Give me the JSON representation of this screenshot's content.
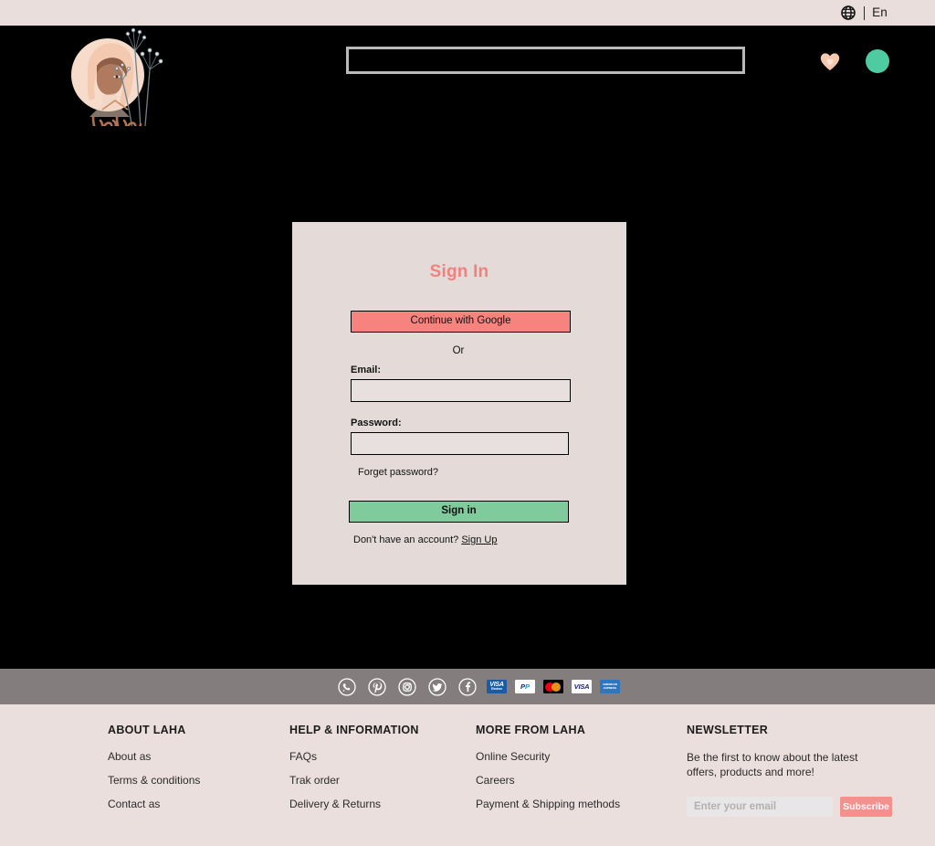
{
  "topbar": {
    "globe_icon": "globe-icon",
    "language": "En"
  },
  "header": {
    "logo_alt": "Laha",
    "search_placeholder": "",
    "search_value": "",
    "wishlist_icon": "heart-icon",
    "cart_icon": "cart-circle-icon",
    "accent_heart": "#F5C8B0",
    "accent_cart": "#4ECBA0"
  },
  "signin": {
    "title": "Sign In",
    "google_button": "Continue with Google",
    "or": "Or",
    "email_label": "Email:",
    "email_value": "",
    "email_placeholder": "",
    "password_label": "Password:",
    "password_value": "",
    "password_placeholder": "",
    "forget_password": "Forget password?",
    "submit_button": "Sign in",
    "signup_prompt": "Don't have an account?",
    "signup_link": "Sign Up",
    "card_bg": "#E4DBD9",
    "title_color": "#F0827E",
    "google_btn_color": "#F7837F",
    "submit_btn_color": "#7FCB9B"
  },
  "socialbar": {
    "bar_color": "#837D7E",
    "socials": [
      {
        "name": "whatsapp-icon",
        "label": "WhatsApp"
      },
      {
        "name": "pinterest-icon",
        "label": "Pinterest"
      },
      {
        "name": "instagram-icon",
        "label": "Instagram"
      },
      {
        "name": "twitter-icon",
        "label": "Twitter"
      },
      {
        "name": "facebook-icon",
        "label": "Facebook"
      }
    ],
    "payments": [
      {
        "name": "visa-electron-card",
        "line1": "VISA",
        "line2": "Electron"
      },
      {
        "name": "paypal-card",
        "label": "PayPal"
      },
      {
        "name": "mastercard-card",
        "label": "mastercard"
      },
      {
        "name": "visa-card",
        "label": "VISA"
      },
      {
        "name": "amex-card",
        "line1": "AMERICAN",
        "line2": "EXPRESS"
      }
    ]
  },
  "footer": {
    "bg": "#EADFDD",
    "columns": [
      {
        "heading": "ABOUT LAHA",
        "links": [
          "About as",
          "Terms & conditions",
          "Contact as"
        ]
      },
      {
        "heading": "HELP & INFORMATION",
        "links": [
          "FAQs",
          "Trak order",
          "Delivery & Returns"
        ]
      },
      {
        "heading": "MORE FROM LAHA",
        "links": [
          "Online Security",
          "Careers",
          "Payment & Shipping methods"
        ]
      }
    ],
    "newsletter": {
      "heading": "NEWSLETTER",
      "description": "Be the first to know about the latest offers, products and more!",
      "input_placeholder": "Enter your email",
      "input_value": "",
      "button": "Subscribe",
      "button_color": "#F2918D"
    }
  }
}
